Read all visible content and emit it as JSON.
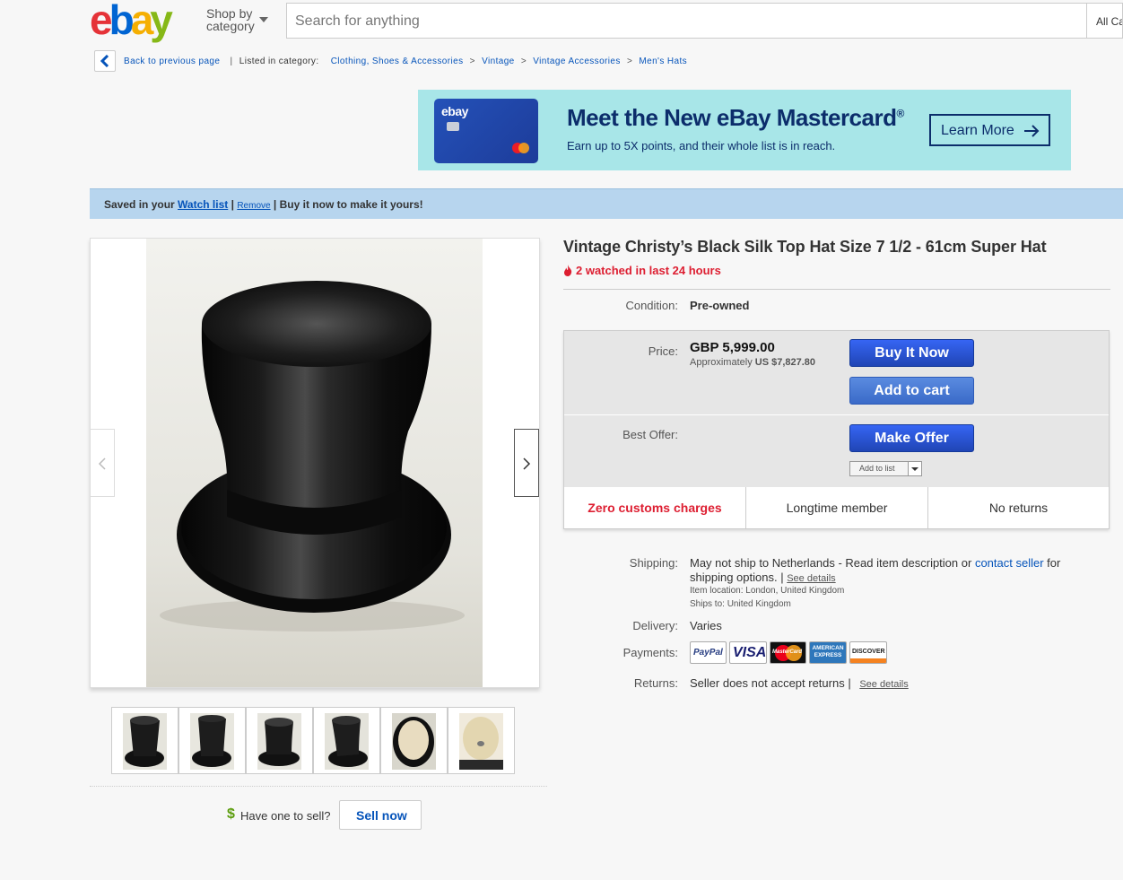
{
  "header": {
    "logo_text": "ebay",
    "shop_by_line1": "Shop by",
    "shop_by_line2": "category",
    "search_placeholder": "Search for anything",
    "all_categories": "All Ca"
  },
  "breadcrumb": {
    "back_label": "Back to previous page",
    "listed_in": "Listed in category:",
    "items": [
      "Clothing, Shoes & Accessories",
      "Vintage",
      "Vintage Accessories",
      "Men's Hats"
    ],
    "separator": ">"
  },
  "ad": {
    "card_logo": "ebay",
    "title": "Meet the New eBay Mastercard",
    "title_reg": "®",
    "subtitle": "Earn up to 5X points, and their whole list is in reach.",
    "cta": "Learn More"
  },
  "watch_bar": {
    "prefix": "Saved in your",
    "watch_list": "Watch list",
    "sep1": "|",
    "remove": "Remove",
    "sep2": "|",
    "suffix": "Buy it now to make it yours!"
  },
  "item": {
    "title": "Vintage Christy’s Black Silk Top Hat Size 7 1/2 - 61cm Super Hat",
    "watched": "2 watched in last 24 hours",
    "condition_label": "Condition:",
    "condition_value": "Pre-owned",
    "price_label": "Price:",
    "price": "GBP 5,999.00",
    "approx_prefix": "Approximately",
    "approx_value": "US $7,827.80",
    "buy_now": "Buy It Now",
    "add_to_cart": "Add to cart",
    "best_offer_label": "Best Offer:",
    "make_offer": "Make Offer",
    "add_to_list": "Add to list",
    "features": [
      "Zero customs charges",
      "Longtime member",
      "No returns"
    ]
  },
  "shipping": {
    "label": "Shipping:",
    "text_a": "May not ship to Netherlands - Read item description or",
    "contact": "contact seller",
    "text_b": "for",
    "text_c": "shipping options.",
    "see_details": "See details",
    "location": "Item location:  London, United Kingdom",
    "ships_to": "Ships to:  United Kingdom"
  },
  "delivery": {
    "label": "Delivery:",
    "value": "Varies"
  },
  "payments": {
    "label": "Payments:",
    "methods": [
      "PayPal",
      "VISA",
      "MasterCard",
      "AMERICAN EXPRESS",
      "DISCOVER"
    ]
  },
  "returns": {
    "label": "Returns:",
    "value": "Seller does not accept returns |",
    "see_details": "See details"
  },
  "sell": {
    "dollar": "$",
    "question": "Have one to sell?",
    "button": "Sell now"
  },
  "colors": {
    "link": "#0654ba",
    "alert_red": "#dd1e31",
    "buy_blue": "#3665f3",
    "banner_bg": "#a8e6e8",
    "watch_bar_bg": "#b7d5ee"
  }
}
